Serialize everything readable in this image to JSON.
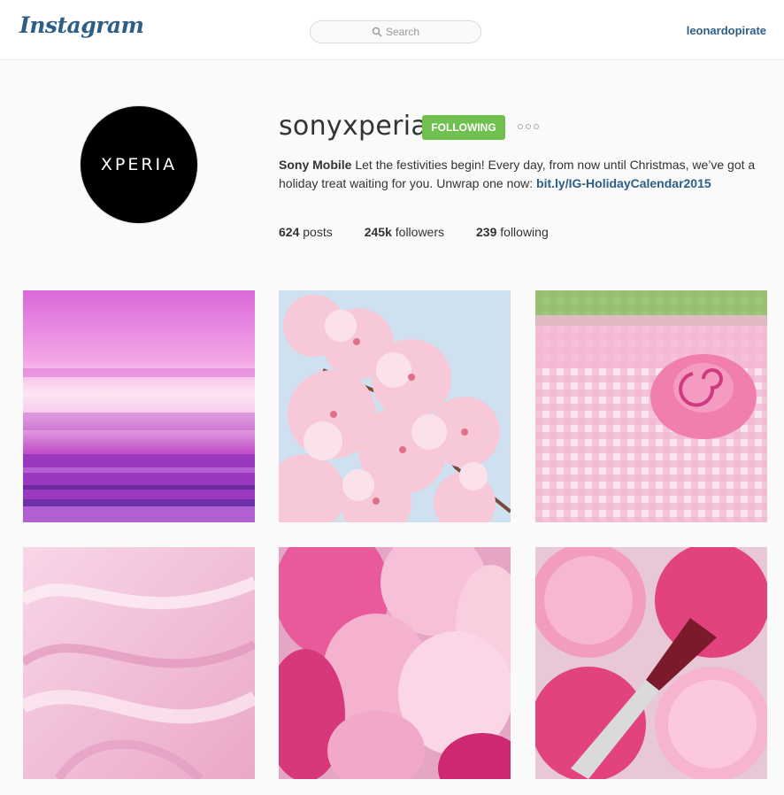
{
  "header": {
    "logo": "Instagram",
    "search_placeholder": "Search",
    "user": "leonardopirate"
  },
  "profile": {
    "avatar_text": "XPERIA",
    "username": "sonyxperia",
    "follow_label": "FOLLOWING",
    "bio_name": "Sony Mobile",
    "bio_text": " Let the festivities begin! Every day, from now until Christmas, we’ve got a holiday treat waiting for you. Unwrap one now: ",
    "bio_link": "bit.ly/IG-HolidayCalendar2015",
    "stats": {
      "posts_count": "624",
      "posts_label": " posts",
      "followers_count": "245k",
      "followers_label": " followers",
      "following_count": "239",
      "following_label": " following"
    }
  },
  "posts": [
    {
      "subject": "pink sunset over sea"
    },
    {
      "subject": "cherry blossoms"
    },
    {
      "subject": "pink fondant rose"
    },
    {
      "subject": "pink silk fabric"
    },
    {
      "subject": "pink balloons"
    },
    {
      "subject": "pink blush with brush"
    }
  ],
  "colors": {
    "brand_blue": "#2e5e86",
    "following_green": "#70c050",
    "background": "#fafafa"
  }
}
